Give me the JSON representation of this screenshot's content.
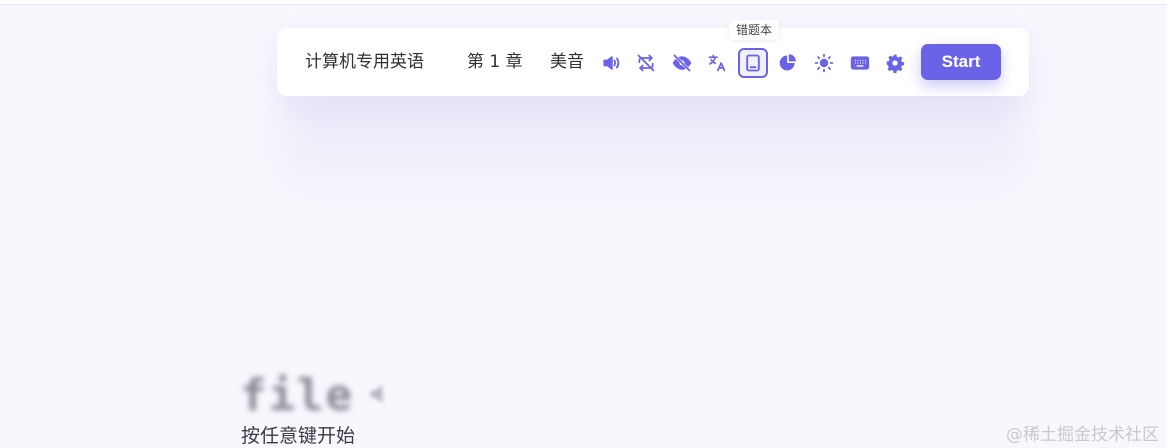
{
  "toolbar": {
    "dictionary": "计算机专用英语",
    "chapter": "第 1 章",
    "pronunciation": "美音",
    "tooltip": "错题本",
    "start_label": "Start",
    "icons": [
      "speaker-icon",
      "loop-off-icon",
      "eye-off-icon",
      "translate-icon",
      "error-book-icon",
      "stats-icon",
      "brightness-icon",
      "keyboard-icon",
      "settings-icon"
    ]
  },
  "word": {
    "text": "file"
  },
  "hint": "按任意键开始",
  "watermark": "@稀土掘金技术社区",
  "colors": {
    "accent": "#6a63e8",
    "background": "#f8f7fd"
  }
}
